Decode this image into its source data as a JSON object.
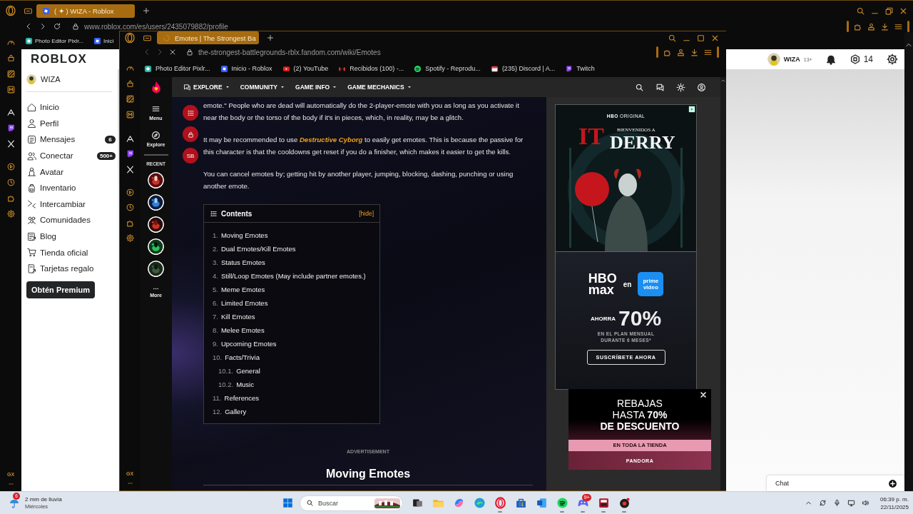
{
  "back_window": {
    "tab": {
      "label": "( ✦ ) WIZA - Roblox",
      "selected": true
    },
    "address": "www.roblox.com/es/users/2435079882/profile",
    "bookmarks": [
      {
        "label": "Photo Editor Pixlr..."
      },
      {
        "label": "Inici"
      }
    ],
    "sidebar_label": "GX",
    "page": {
      "logo": "ROBLOX",
      "user": "WIZA",
      "nav": [
        {
          "label": "Inicio"
        },
        {
          "label": "Perfil"
        },
        {
          "label": "Mensajes",
          "badge": "6"
        },
        {
          "label": "Conectar",
          "badge": "500+"
        },
        {
          "label": "Avatar"
        },
        {
          "label": "Inventario"
        },
        {
          "label": "Intercambiar"
        },
        {
          "label": "Comunidades"
        },
        {
          "label": "Blog"
        },
        {
          "label": "Tienda oficial"
        },
        {
          "label": "Tarjetas regalo"
        }
      ],
      "premium_button": "Obtén Premium",
      "header": {
        "user": "WIZA",
        "age": "13+",
        "robux": "14"
      },
      "chat": "Chat"
    }
  },
  "front_window": {
    "tab": {
      "label": "Emotes | The Strongest Ba",
      "selected": true
    },
    "address": "the-strongest-battlegrounds-rblx.fandom.com/wiki/Emotes",
    "bookmarks": [
      {
        "label": "Photo Editor Pixlr..."
      },
      {
        "label": "Inicio - Roblox"
      },
      {
        "label": "(2) YouTube"
      },
      {
        "label": "Recibidos (100) -..."
      },
      {
        "label": "Spotify - Reprodu..."
      },
      {
        "label": "(235) Discord | A..."
      },
      {
        "label": "Twitch"
      }
    ],
    "sidebar_label": "GX",
    "rail": {
      "menu": "Menu",
      "explore": "Explore",
      "recent": "RECENT",
      "more": "More"
    },
    "nav": [
      "EXPLORE",
      "COMMUNITY",
      "GAME INFO",
      "GAME MECHANICS"
    ],
    "article": {
      "tool_label": "SB",
      "paragraphs": [
        {
          "text": "emote.\" People who are dead will automatically do the 2-player-emote with you as long as you activate it near the body or the torso of the body if it's in pieces, which, in reality, may be a glitch."
        },
        {
          "before": "It may be recommended to use ",
          "link": "Destructive Cyborg",
          "after": " to easily get emotes. This is because the passive for this character is that the cooldowns get reset if you do a finisher, which makes it easier to get the kills."
        },
        {
          "text": "You can cancel emotes by; getting hit by another player, jumping, blocking, dashing, punching or using another emote."
        }
      ],
      "contents": {
        "title": "Contents",
        "toggle": "[hide]",
        "items": [
          {
            "number": "1.",
            "label": "Moving Emotes"
          },
          {
            "number": "2.",
            "label": "Dual Emotes/Kill Emotes"
          },
          {
            "number": "3.",
            "label": "Status Emotes"
          },
          {
            "number": "4.",
            "label": "Still/Loop Emotes (May include partner emotes.)"
          },
          {
            "number": "5.",
            "label": "Meme Emotes"
          },
          {
            "number": "6.",
            "label": "Limited Emotes"
          },
          {
            "number": "7.",
            "label": "Kill Emotes"
          },
          {
            "number": "8.",
            "label": "Melee Emotes"
          },
          {
            "number": "9.",
            "label": "Upcoming Emotes"
          },
          {
            "number": "10.",
            "label": "Facts/Trivia",
            "children": [
              {
                "number": "10.1.",
                "label": "General"
              },
              {
                "number": "10.2.",
                "label": "Music"
              }
            ]
          },
          {
            "number": "11.",
            "label": "References"
          },
          {
            "number": "12.",
            "label": "Gallery"
          }
        ]
      },
      "advertisement_label": "ADVERTISEMENT",
      "heading": "Moving Emotes"
    },
    "ads": {
      "first": {
        "badge": "**HBO** ORIGINAL",
        "mark": "IT",
        "subtitle": "BIENVENIDOS A",
        "title": "DERRY",
        "brand": [
          "HBO",
          "max"
        ],
        "joiner": "en",
        "partner": [
          "prime",
          "video"
        ],
        "save": "AHORRA",
        "percent": "70%",
        "terms": [
          "EN EL PLAN MENSUAL",
          "DURANTE 6 MESES*"
        ],
        "button": "SUSCRÍBETE AHORA"
      },
      "second": {
        "lines": [
          "REBAJAS",
          "HASTA **70%**",
          "DE DESCUENTO"
        ],
        "stripe": "EN TODA LA TIENDA",
        "brand": "PANDORA"
      }
    }
  },
  "taskbar": {
    "weather": {
      "badge": "6",
      "title": "2 mm de lluvia",
      "subtitle": "Miércoles"
    },
    "search": "Buscar",
    "apps": [
      {
        "open": false
      },
      {
        "open": false
      },
      {
        "open": false
      },
      {
        "open": false
      },
      {
        "open": true
      },
      {
        "open": false
      },
      {
        "open": false
      },
      {
        "open": true
      },
      {
        "open": true,
        "badge": "9+"
      },
      {
        "open": true
      },
      {
        "open": true
      }
    ],
    "time": "06:39 p. m.",
    "date": "22/11/2025"
  }
}
